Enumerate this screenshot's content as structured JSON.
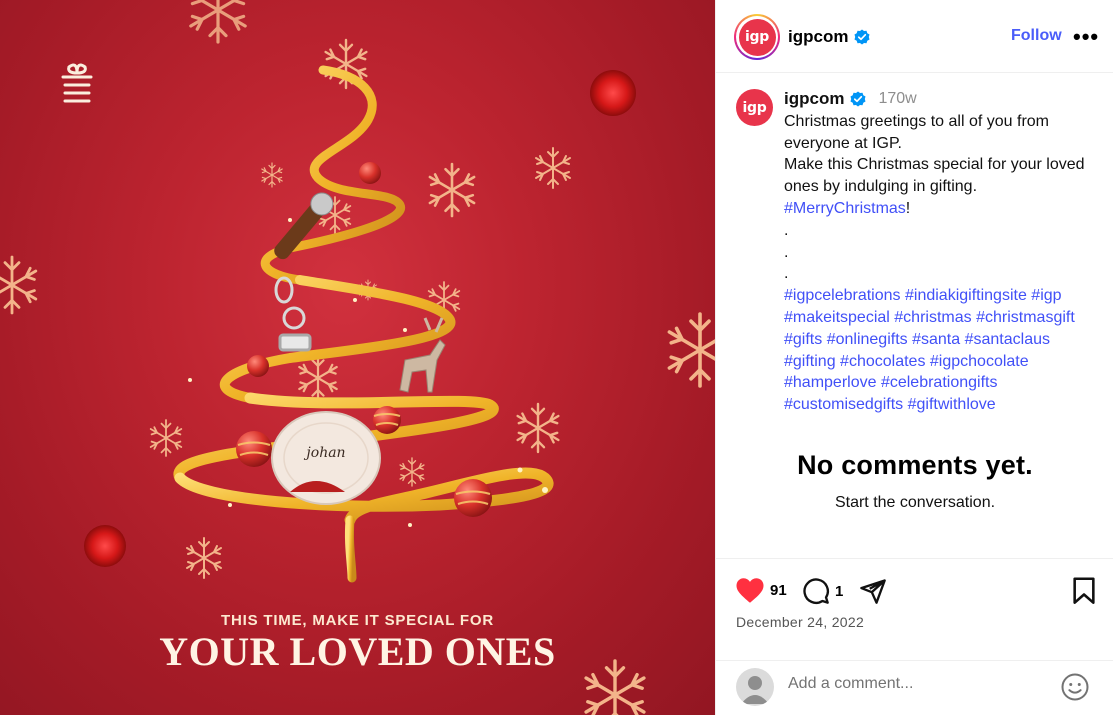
{
  "post": {
    "image": {
      "tagline_small": "THIS TIME, MAKE IT SPECIAL FOR",
      "tagline_big": "YOUR LOVED ONES",
      "plate_text": "johan"
    },
    "header": {
      "avatar_text": "igp",
      "username": "igpcom",
      "follow_label": "Follow",
      "more_label": "•••"
    },
    "caption": {
      "avatar_text": "igp",
      "username": "igpcom",
      "time": "170w",
      "lines": [
        "Christmas greetings to all of you from",
        "everyone at IGP.",
        "Make this Christmas special for your loved",
        "ones by indulging in gifting."
      ],
      "hashtag_main": "#MerryChristmas",
      "hashtag_main_suffix": "!",
      "dots": [
        ".",
        ".",
        "."
      ],
      "hashtags": [
        "#igpcelebrations",
        "#indiakigiftingsite",
        "#igp",
        "#makeitspecial",
        "#christmas",
        "#christmasgift",
        "#gifts",
        "#onlinegifts",
        "#santa",
        "#santaclaus",
        "#gifting",
        "#chocolates",
        "#igpchocolate",
        "#hamperlove",
        "#celebrationgifts",
        "#customisedgifts",
        "#giftwithlove"
      ]
    },
    "comments": {
      "empty_title": "No comments yet.",
      "empty_subtitle": "Start the conversation."
    },
    "actions": {
      "likes": "91",
      "comments": "1",
      "date": "December 24, 2022"
    },
    "comment_input": {
      "placeholder": "Add a comment..."
    },
    "colors": {
      "accent_link": "#4150f7",
      "follow": "#4a5df9",
      "like_red": "#ff3040",
      "brand_red": "#e8344b",
      "background_red": "#bd2430"
    }
  }
}
